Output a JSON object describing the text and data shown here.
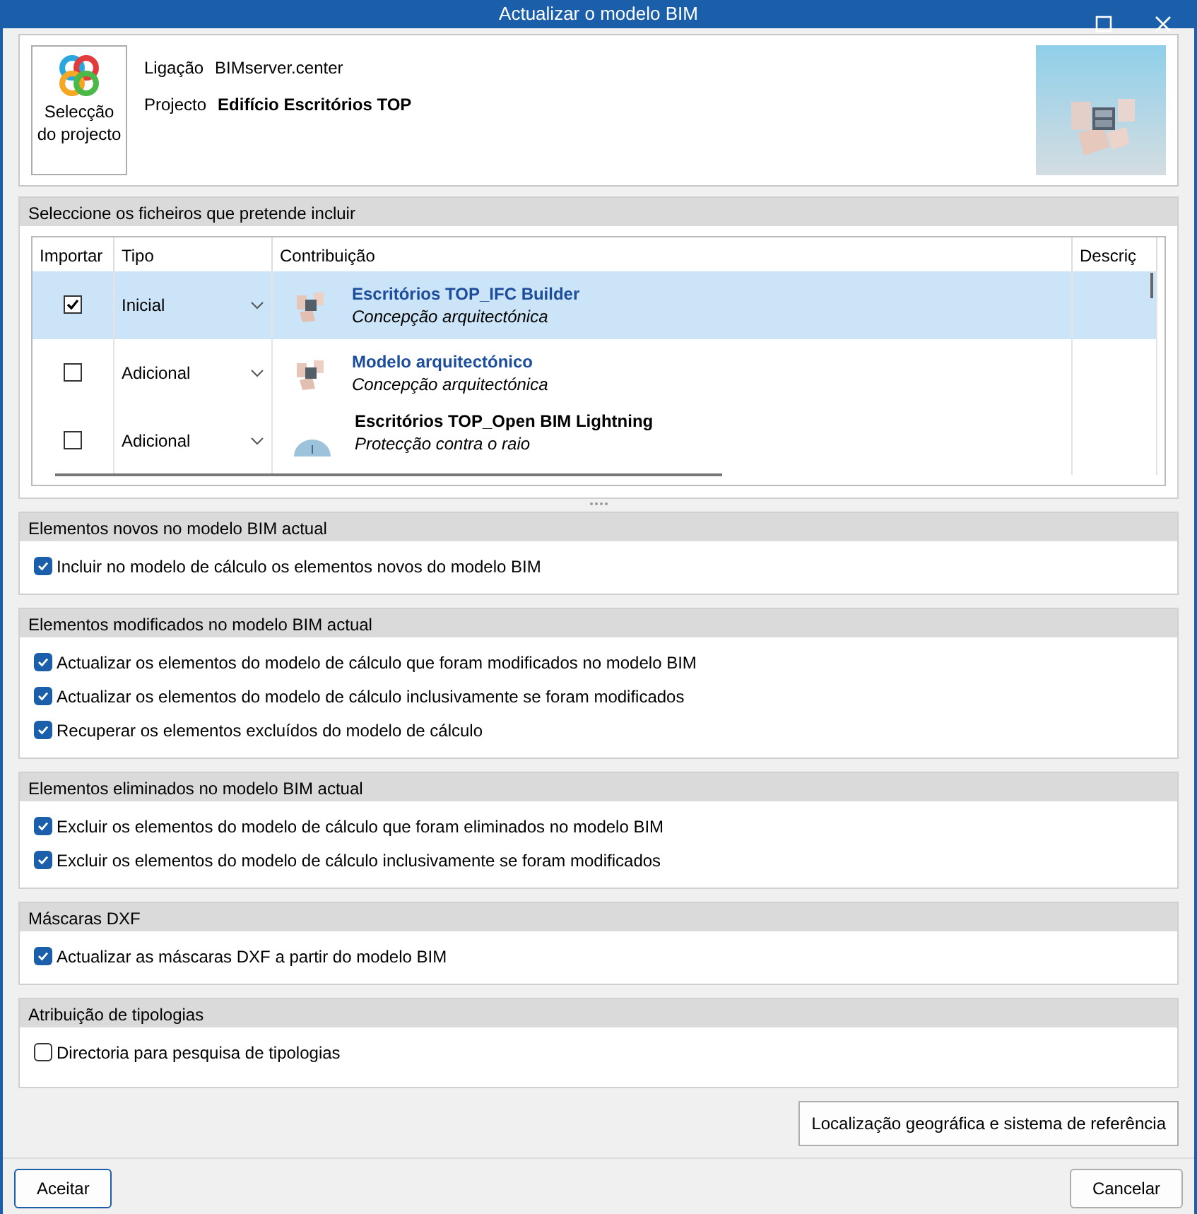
{
  "window": {
    "title": "Actualizar o modelo BIM"
  },
  "project": {
    "button_label": "Selecção do projecto",
    "fields": [
      {
        "label": "Ligação",
        "value": "BIMserver.center",
        "bold": false
      },
      {
        "label": "Projecto",
        "value": "Edifício Escritórios TOP",
        "bold": true
      }
    ]
  },
  "files": {
    "title": "Seleccione os ficheiros que pretende incluir",
    "columns": [
      "Importar",
      "Tipo",
      "Contribuição",
      "Descriç"
    ],
    "rows": [
      {
        "selected": true,
        "checked": true,
        "type": "Inicial",
        "name": "Escritórios TOP_IFC Builder",
        "linked": true,
        "description": "Concepção arquitectónica",
        "kind": "building"
      },
      {
        "selected": false,
        "checked": false,
        "type": "Adicional",
        "name": "Modelo arquitectónico",
        "linked": true,
        "description": "Concepção arquitectónica",
        "kind": "building"
      },
      {
        "selected": false,
        "checked": false,
        "type": "Adicional",
        "name": "Escritórios TOP_Open BIM Lightning",
        "linked": false,
        "description": "Protecção contra o raio",
        "kind": "dome"
      }
    ]
  },
  "sections": [
    {
      "title": "Elementos novos no modelo BIM actual",
      "options": [
        {
          "label": "Incluir no modelo de cálculo os elementos novos do modelo BIM",
          "checked": true
        }
      ]
    },
    {
      "title": "Elementos modificados no modelo BIM actual",
      "options": [
        {
          "label": "Actualizar os elementos do modelo de cálculo que foram modificados no modelo BIM",
          "checked": true
        },
        {
          "label": "Actualizar os elementos do modelo de cálculo inclusivamente se foram modificados",
          "checked": true
        },
        {
          "label": "Recuperar os elementos excluídos do modelo de cálculo",
          "checked": true
        }
      ]
    },
    {
      "title": "Elementos eliminados no modelo BIM actual",
      "options": [
        {
          "label": "Excluir os elementos do modelo de cálculo que foram eliminados no modelo BIM",
          "checked": true
        },
        {
          "label": "Excluir os elementos do modelo de cálculo inclusivamente se foram modificados",
          "checked": true
        }
      ]
    },
    {
      "title": "Máscaras DXF",
      "options": [
        {
          "label": "Actualizar as máscaras DXF a partir do modelo BIM",
          "checked": true
        }
      ]
    },
    {
      "title": "Atribuição de tipologias",
      "options": [
        {
          "label": "Directoria para pesquisa de tipologias",
          "checked": false
        }
      ]
    }
  ],
  "geo_button": "Localização geográfica e sistema de referência",
  "buttons": {
    "accept": "Aceitar",
    "cancel": "Cancelar"
  }
}
